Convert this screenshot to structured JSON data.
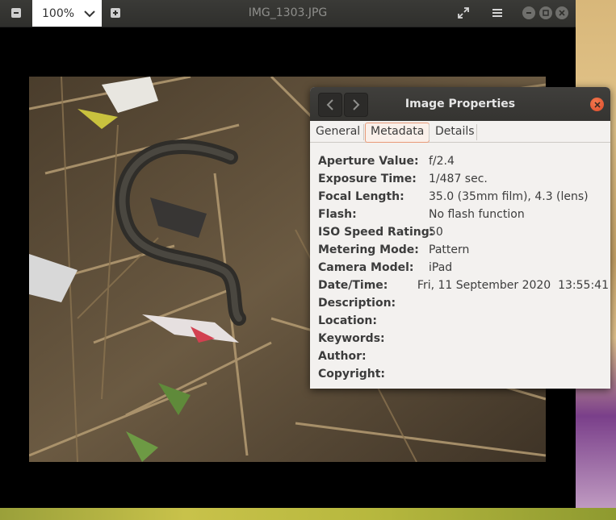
{
  "viewer": {
    "title": "IMG_1303.JPG",
    "zoom": "100%"
  },
  "dialog": {
    "title": "Image Properties",
    "tabs": [
      {
        "label": "General",
        "active": false
      },
      {
        "label": "Metadata",
        "active": true
      },
      {
        "label": "Details",
        "active": false
      }
    ],
    "properties": [
      {
        "key": "Aperture Value:",
        "value": "f/2.4"
      },
      {
        "key": "Exposure Time:",
        "value": "1/487 sec."
      },
      {
        "key": "Focal Length:",
        "value": "35.0 (35mm film), 4.3 (lens)"
      },
      {
        "key": "Flash:",
        "value": "No flash function"
      },
      {
        "key": "ISO Speed Rating:",
        "value": "50"
      },
      {
        "key": "Metering Mode:",
        "value": "Pattern"
      },
      {
        "key": "Camera Model:",
        "value": "iPad"
      },
      {
        "key": "Date/Time:",
        "value": "Fri, 11 September 2020  13:55:41"
      },
      {
        "key": "Description:",
        "value": ""
      },
      {
        "key": "Location:",
        "value": ""
      },
      {
        "key": "Keywords:",
        "value": ""
      },
      {
        "key": "Author:",
        "value": ""
      },
      {
        "key": "Copyright:",
        "value": ""
      }
    ]
  },
  "colors": {
    "accent": "#e95420",
    "headerbar": "#33332f",
    "dialog_bg": "#f3f1ef"
  },
  "icons": [
    "zoom-out-icon",
    "chevron-down-icon",
    "zoom-in-icon",
    "fullscreen-icon",
    "hamburger-menu-icon",
    "minimize-icon",
    "maximize-icon",
    "close-icon",
    "back-icon",
    "forward-icon",
    "dialog-close-icon"
  ]
}
